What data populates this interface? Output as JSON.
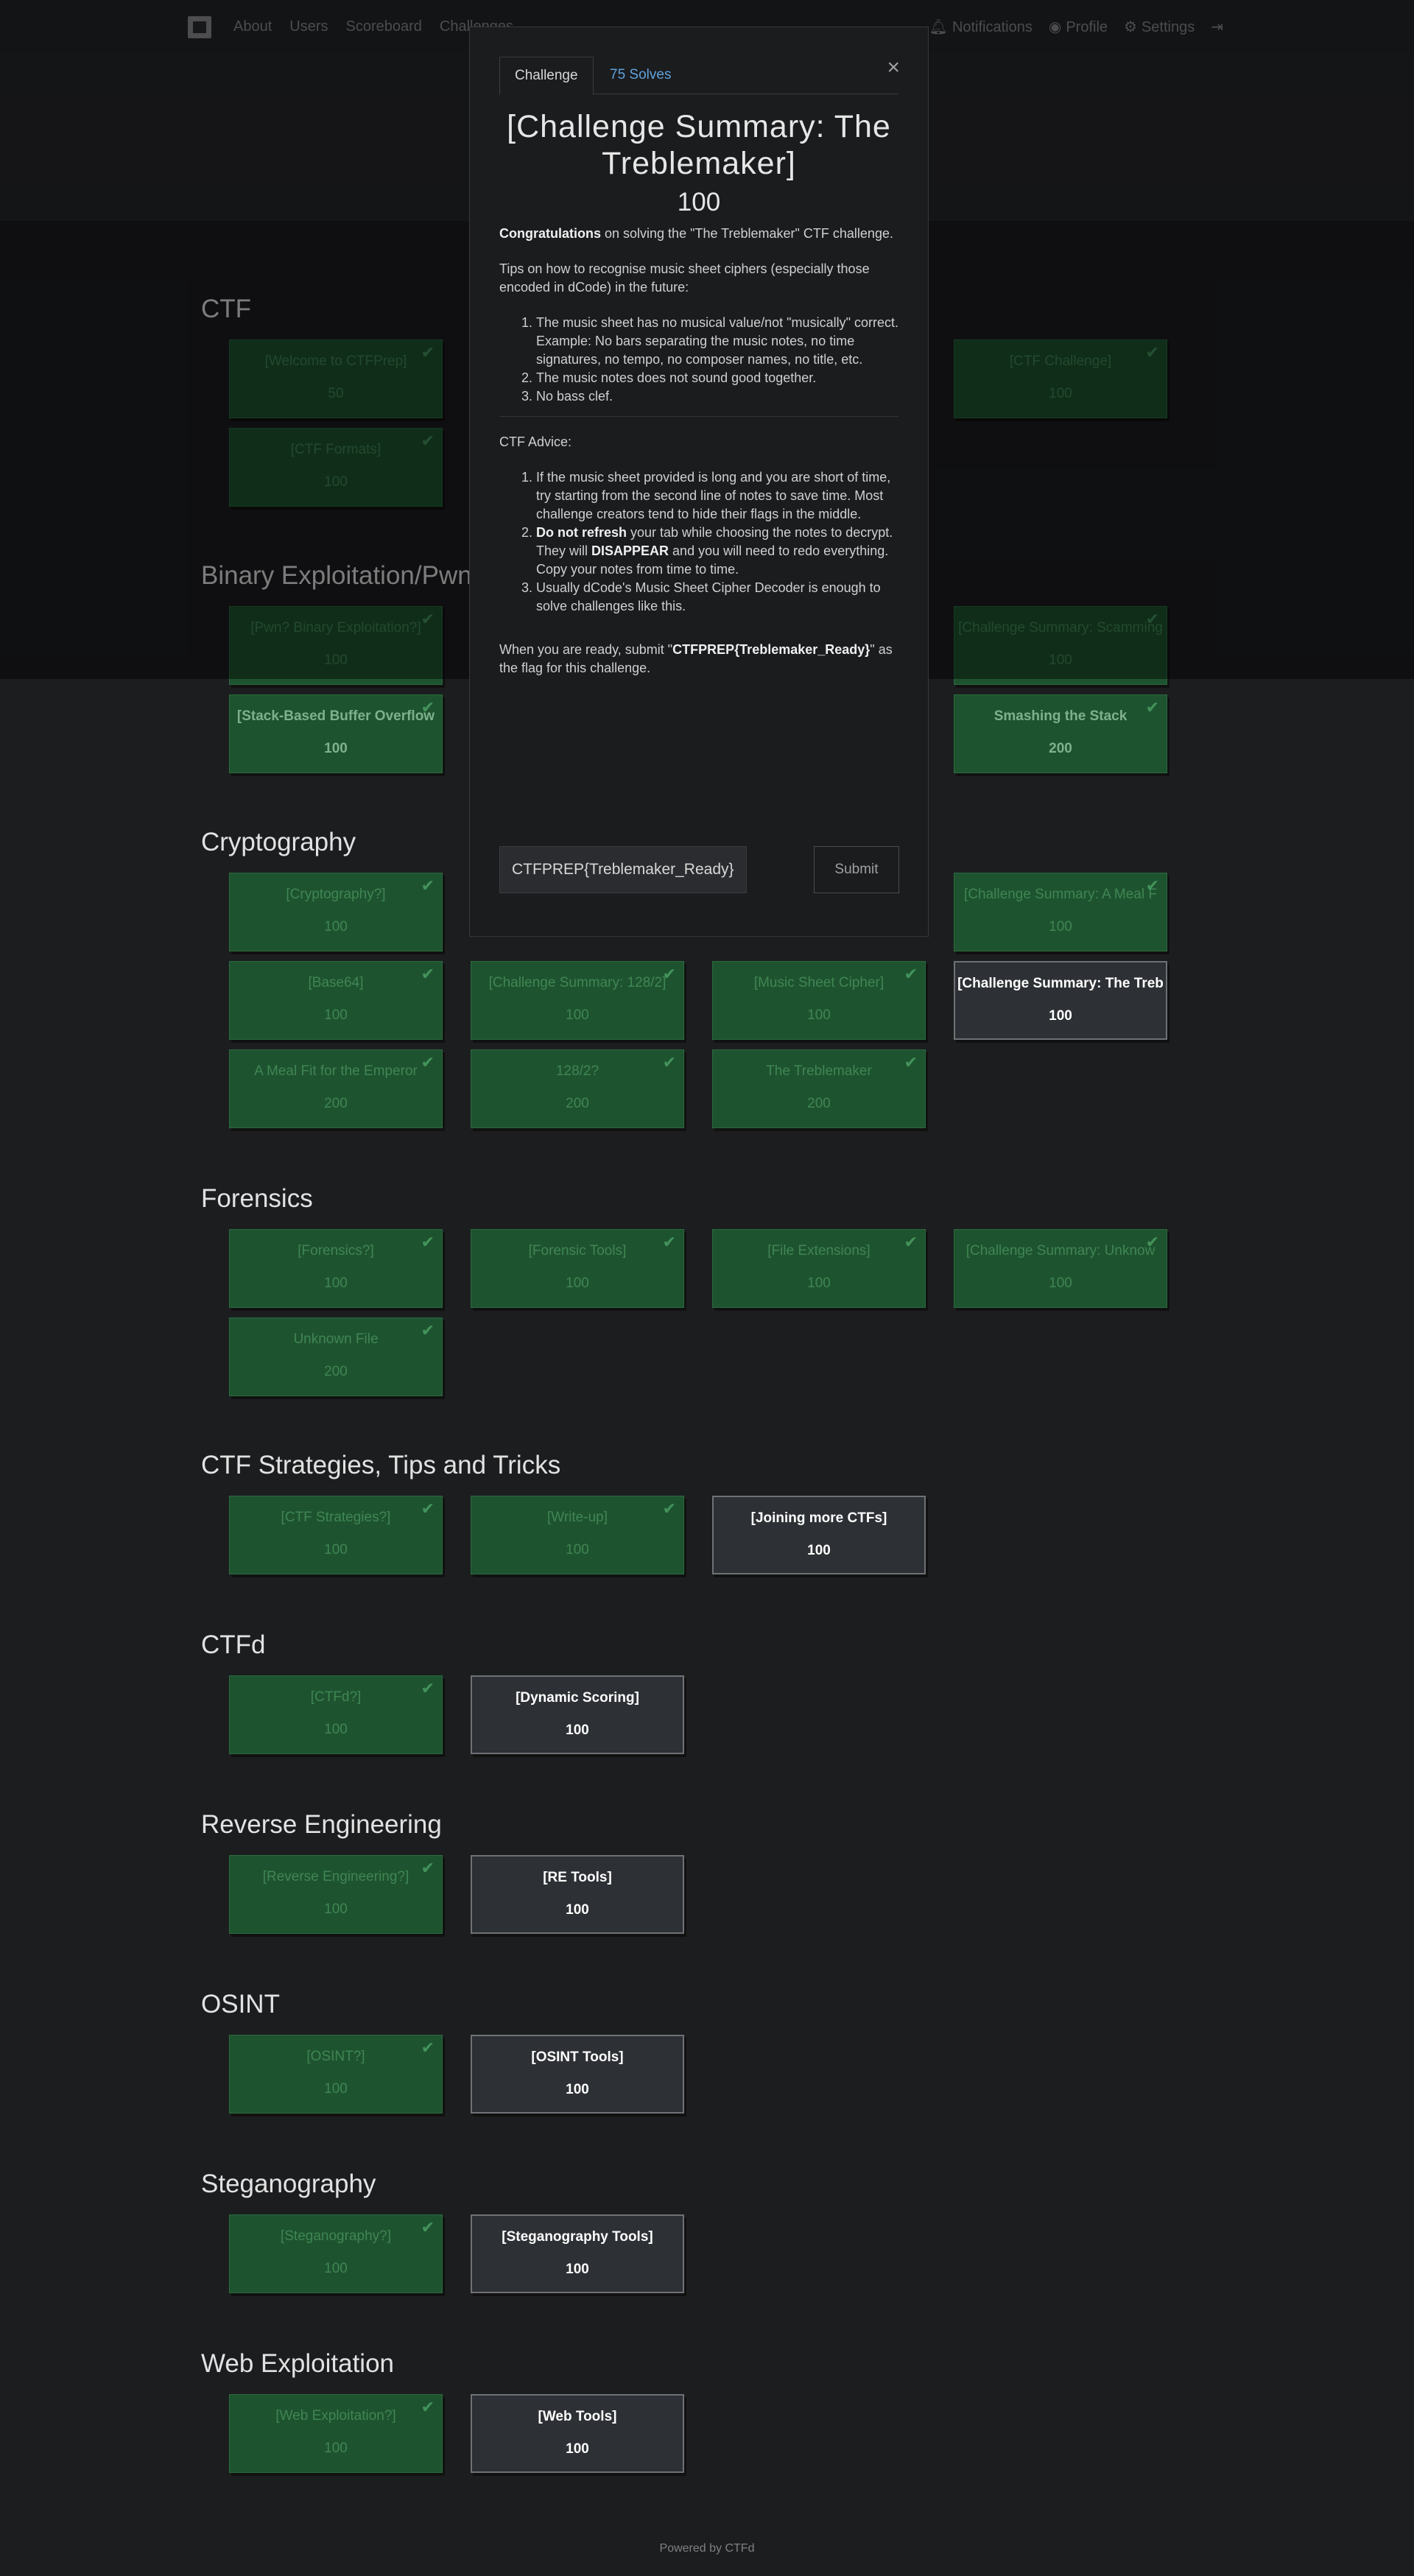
{
  "nav": {
    "left": [
      "About",
      "Users",
      "Scoreboard",
      "Challenges"
    ],
    "right": [
      {
        "icon": "bell-icon",
        "label": "Notifications"
      },
      {
        "icon": "user-circle-icon",
        "label": "Profile"
      },
      {
        "icon": "gears-icon",
        "label": "Settings"
      },
      {
        "icon": "sign-out-icon",
        "label": ""
      }
    ]
  },
  "categories": [
    {
      "title": "CTF",
      "challenges": [
        {
          "name": "[Welcome to CTFPrep]",
          "value": "50",
          "solved": true
        },
        {
          "name": "",
          "value": "",
          "solved": true,
          "hidden": true
        },
        {
          "name": "",
          "value": "",
          "solved": true,
          "hidden": true
        },
        {
          "name": "[CTF Challenge]",
          "value": "100",
          "solved": true
        },
        {
          "name": "[CTF Formats]",
          "value": "100",
          "solved": true
        },
        {
          "name": "",
          "value": "",
          "solved": true,
          "hidden": true
        }
      ]
    },
    {
      "title": "Binary Exploitation/Pwn",
      "challenges": [
        {
          "name": "[Pwn? Binary Exploitation?]",
          "value": "100",
          "solved": true
        },
        {
          "name": "",
          "value": "",
          "solved": true,
          "hidden": true
        },
        {
          "name": "",
          "value": "",
          "solved": true,
          "hidden": true
        },
        {
          "name": "[Challenge Summary: Scamming",
          "value": "100",
          "solved": true
        },
        {
          "name": "[Stack-Based Buffer Overflow",
          "value": "100",
          "solved": true,
          "bright": true
        },
        {
          "name": "",
          "value": "",
          "solved": true,
          "hidden": true
        },
        {
          "name": "",
          "value": "",
          "solved": true,
          "hidden": true
        },
        {
          "name": "Smashing the Stack",
          "value": "200",
          "solved": true,
          "bright": true
        }
      ]
    },
    {
      "title": "Cryptography",
      "challenges": [
        {
          "name": "[Cryptography?]",
          "value": "100",
          "solved": true
        },
        {
          "name": "",
          "value": "",
          "solved": true,
          "hidden": true
        },
        {
          "name": "",
          "value": "",
          "solved": true,
          "hidden": true
        },
        {
          "name": "[Challenge Summary: A Meal F",
          "value": "100",
          "solved": true
        },
        {
          "name": "[Base64]",
          "value": "100",
          "solved": true
        },
        {
          "name": "[Challenge Summary: 128/2]",
          "value": "100",
          "solved": true
        },
        {
          "name": "[Music Sheet Cipher]",
          "value": "100",
          "solved": true
        },
        {
          "name": "[Challenge Summary: The Treb",
          "value": "100",
          "solved": false
        },
        {
          "name": "A Meal Fit for the Emperor",
          "value": "200",
          "solved": true
        },
        {
          "name": "128/2?",
          "value": "200",
          "solved": true
        },
        {
          "name": "The Treblemaker",
          "value": "200",
          "solved": true
        }
      ]
    },
    {
      "title": "Forensics",
      "challenges": [
        {
          "name": "[Forensics?]",
          "value": "100",
          "solved": true
        },
        {
          "name": "[Forensic Tools]",
          "value": "100",
          "solved": true
        },
        {
          "name": "[File Extensions]",
          "value": "100",
          "solved": true
        },
        {
          "name": "[Challenge Summary: Unknow",
          "value": "100",
          "solved": true
        },
        {
          "name": "Unknown File",
          "value": "200",
          "solved": true
        }
      ]
    },
    {
      "title": "CTF Strategies, Tips and Tricks",
      "challenges": [
        {
          "name": "[CTF Strategies?]",
          "value": "100",
          "solved": true
        },
        {
          "name": "[Write-up]",
          "value": "100",
          "solved": true
        },
        {
          "name": "[Joining more CTFs]",
          "value": "100",
          "solved": false
        }
      ]
    },
    {
      "title": "CTFd",
      "challenges": [
        {
          "name": "[CTFd?]",
          "value": "100",
          "solved": true
        },
        {
          "name": "[Dynamic Scoring]",
          "value": "100",
          "solved": false
        }
      ]
    },
    {
      "title": "Reverse Engineering",
      "challenges": [
        {
          "name": "[Reverse Engineering?]",
          "value": "100",
          "solved": true
        },
        {
          "name": "[RE Tools]",
          "value": "100",
          "solved": false
        }
      ]
    },
    {
      "title": "OSINT",
      "challenges": [
        {
          "name": "[OSINT?]",
          "value": "100",
          "solved": true
        },
        {
          "name": "[OSINT Tools]",
          "value": "100",
          "solved": false
        }
      ]
    },
    {
      "title": "Steganography",
      "challenges": [
        {
          "name": "[Steganography?]",
          "value": "100",
          "solved": true
        },
        {
          "name": "[Steganography Tools]",
          "value": "100",
          "solved": false
        }
      ]
    },
    {
      "title": "Web Exploitation",
      "challenges": [
        {
          "name": "[Web Exploitation?]",
          "value": "100",
          "solved": true
        },
        {
          "name": "[Web Tools]",
          "value": "100",
          "solved": false
        }
      ]
    }
  ],
  "modal": {
    "tab_challenge": "Challenge",
    "tab_solves": "75 Solves",
    "close": "×",
    "title": "[Challenge Summary: The Treblemaker]",
    "value": "100",
    "congrats_bold": "Congratulations",
    "congrats_rest": " on solving the \"The Treblemaker\" CTF challenge.",
    "tips_intro": "Tips on how to recognise music sheet ciphers (especially those encoded in dCode) in the future:",
    "tips": [
      "The music sheet has no musical value/not \"musically\" correct. Example: No bars separating the music notes, no time signatures, no tempo, no composer names, no title, etc.",
      "The music notes does not sound good together.",
      "No bass clef."
    ],
    "advice_title": "CTF Advice:",
    "advice1": "If the music sheet provided is long and you are short of time, try starting from the second line of notes to save time. Most challenge creators tend to hide their flags in the middle.",
    "advice2_b1": "Do not refresh",
    "advice2_t1": " your tab while choosing the notes to decrypt. They will ",
    "advice2_b2": "DISAPPEAR",
    "advice2_t2": " and you will need to redo everything. Copy your notes from time to time.",
    "advice3": "Usually dCode's Music Sheet Cipher Decoder is enough to solve challenges like this.",
    "submit_pre": "When you are ready, submit \"",
    "submit_flag": "CTFPREP{Treblemaker_Ready}",
    "submit_post": "\" as the flag for this challenge.",
    "input_value": "CTFPREP{Treblemaker_Ready}",
    "submit_label": "Submit"
  },
  "footer": "Powered by CTFd"
}
